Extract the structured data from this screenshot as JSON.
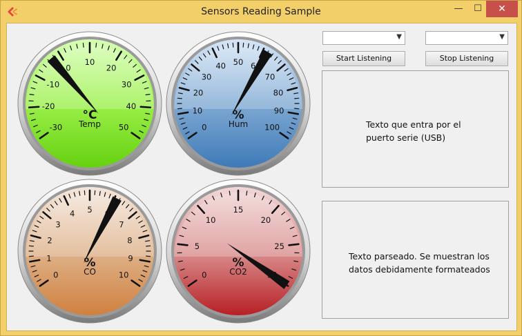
{
  "window": {
    "title": "Sensors Reading Sample"
  },
  "titlebar": {
    "minimize": "—",
    "maximize": "☐",
    "close": "✕"
  },
  "gauges": [
    {
      "id": "temp",
      "unit": "°C",
      "label": "Temp",
      "min": -30,
      "max": 50,
      "value": -3,
      "ticks": [
        "-30",
        "-20",
        "-10",
        "0",
        "10",
        "20",
        "30",
        "40",
        "50"
      ],
      "colors": {
        "top": "#d7ffb5",
        "mid": "#9bf04a",
        "bottom": "#66d10f"
      }
    },
    {
      "id": "hum",
      "unit": "%",
      "label": "Hum",
      "min": 0,
      "max": 100,
      "value": 62,
      "ticks": [
        "0",
        "10",
        "20",
        "30",
        "40",
        "50",
        "60",
        "70",
        "80",
        "90",
        "100"
      ],
      "colors": {
        "top": "#d6e6f6",
        "mid": "#7fa9d3",
        "bottom": "#3e7ab8"
      }
    },
    {
      "id": "co",
      "unit": "%",
      "label": "CO",
      "min": 0,
      "max": 10,
      "value": 6.1,
      "ticks": [
        "0",
        "1",
        "2",
        "3",
        "4",
        "5",
        "6",
        "7",
        "8",
        "9",
        "10"
      ],
      "colors": {
        "top": "#f4e7dc",
        "mid": "#deb28a",
        "bottom": "#d0813f"
      }
    },
    {
      "id": "co2",
      "unit": "%",
      "label": "CO2",
      "min": 0,
      "max": 30,
      "value": 30,
      "ticks": [
        "0",
        "5",
        "10",
        "15",
        "20",
        "25",
        "30"
      ],
      "colors": {
        "top": "#f2d8d8",
        "mid": "#da8f8f",
        "bottom": "#b72025"
      }
    }
  ],
  "controls": {
    "port_combo_value": "",
    "baud_combo_value": "",
    "start_label": "Start Listening",
    "stop_label": "Stop Listening"
  },
  "panels": {
    "raw_text_line1": "Texto que entra por el",
    "raw_text_line2": "puerto serie (USB)",
    "parsed_text_line1": "Texto parseado. Se muestran los",
    "parsed_text_line2": "datos debidamente formateados"
  }
}
